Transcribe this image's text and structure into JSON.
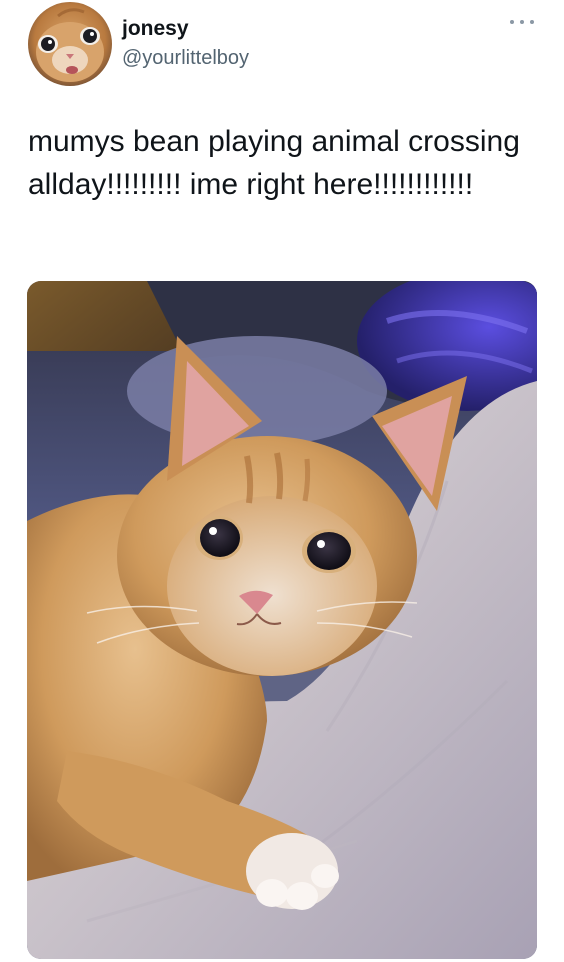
{
  "tweet": {
    "display_name": "jonesy",
    "handle": "@yourlittelboy",
    "text": "mumys bean playing animal crossing allday!!!!!!!!! ime right here!!!!!!!!!!!!",
    "avatar_icon": "kitten-avatar",
    "more_icon": "more-options-icon",
    "media_description_icon": "kitten-photo"
  },
  "colors": {
    "text_primary": "#0f1419",
    "text_secondary": "#536471",
    "background": "#ffffff",
    "kitten_orange": "#d9a263",
    "blanket": "#cfc9d0",
    "cushion_blue": "#4a3fb8"
  }
}
